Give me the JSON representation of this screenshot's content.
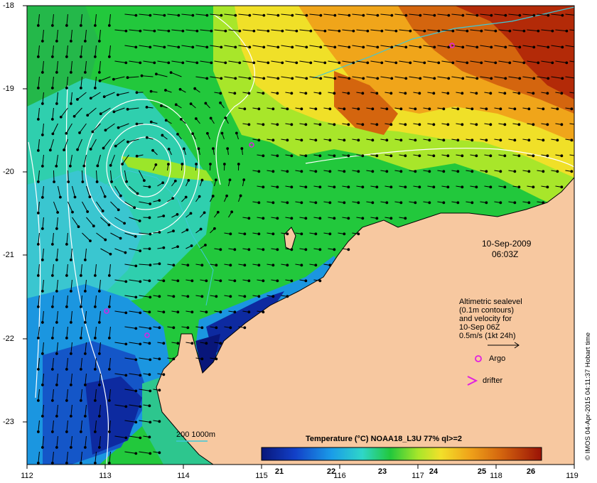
{
  "date": "10-Sep-2009",
  "time": "06:03Z",
  "legend_lines": [
    "Altimetric sealevel",
    "(0.1m contours)",
    "and velocity for",
    "10-Sep 06Z",
    "0.5m/s (1kt 24h)"
  ],
  "argo_label": "Argo",
  "drifter_label": "drifter",
  "depth_label": "200  1000m",
  "colorbar_title": "Temperature (°C) NOAA18_L3U 77% ql>=2",
  "colorbar_ticks": [
    "21",
    "22",
    "23",
    "24",
    "25",
    "26"
  ],
  "colorbar_colors": [
    "#0b1a8e",
    "#1350d2",
    "#1aa5e6",
    "#2fd2c8",
    "#22c83c",
    "#9be62a",
    "#f0e228",
    "#f0a51a",
    "#d4650e",
    "#a81806"
  ],
  "lat_labels": [
    "-18",
    "-19",
    "-20",
    "-21",
    "-22",
    "-23"
  ],
  "lon_labels": [
    "112",
    "113",
    "114",
    "115",
    "116",
    "117",
    "118",
    "119"
  ],
  "credit": "© IMOS 04-Apr-2015 04:11:37 Hobart time",
  "land_color": "#f7c8a0"
}
